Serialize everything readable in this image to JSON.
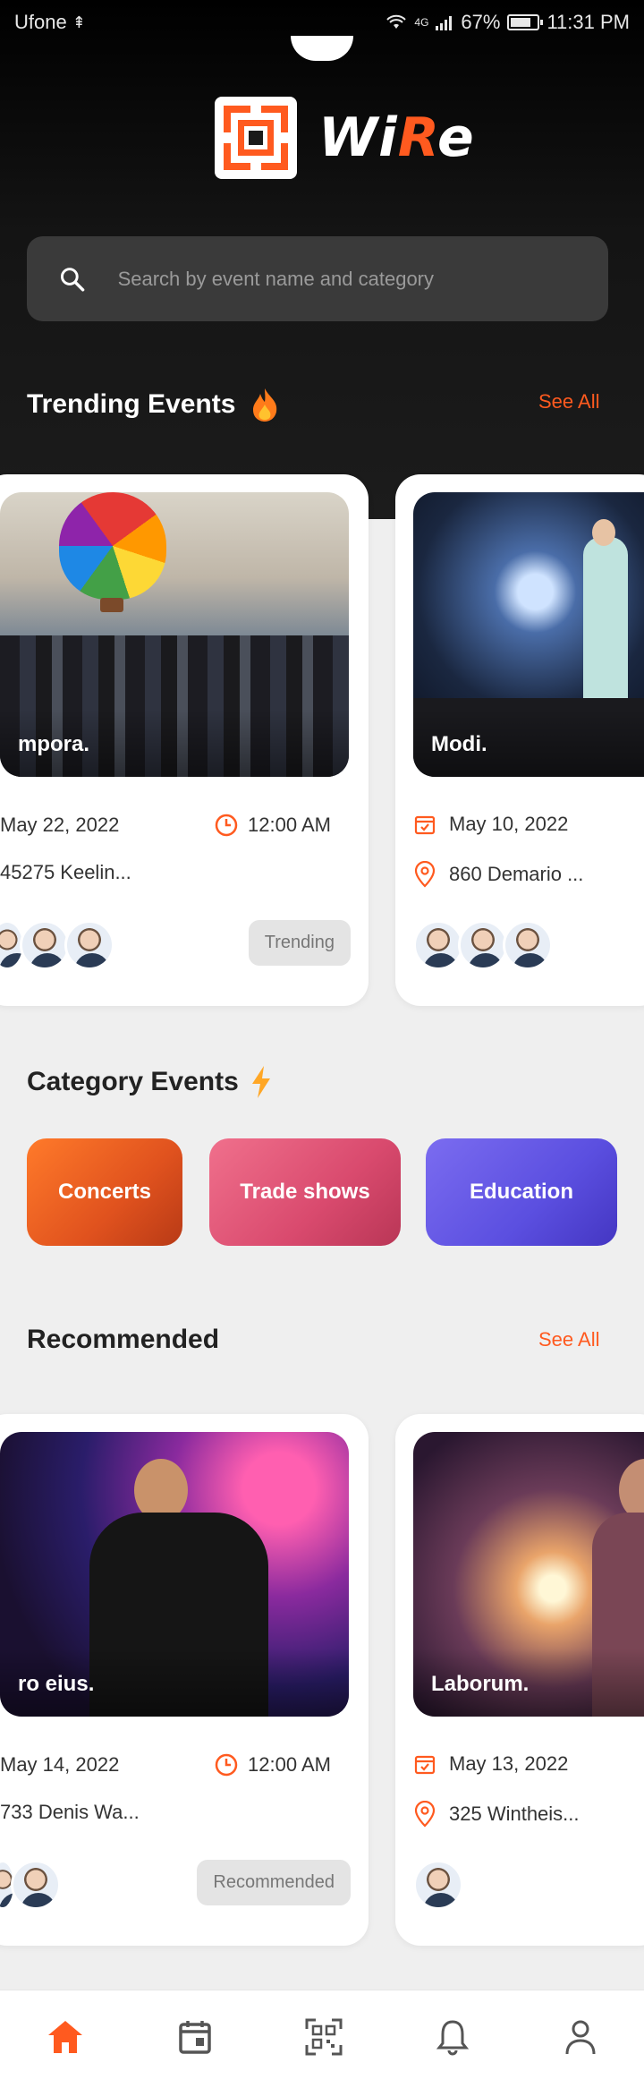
{
  "status_bar": {
    "carrier": "Ufone",
    "network": "4G",
    "battery": "67%",
    "time": "11:31 PM"
  },
  "brand": {
    "name_prefix": "Wi",
    "name_accent": "R",
    "name_suffix": "e",
    "accent_color": "#ff5a1f"
  },
  "search": {
    "placeholder": "Search by event name and category",
    "icon": "search-icon"
  },
  "trending": {
    "title": "Trending Events",
    "title_icon": "fire-icon",
    "see_all": "See All",
    "cards": [
      {
        "name": "mpora.",
        "date": "May 22, 2022",
        "time": "12:00 AM",
        "address": "45275 Keelin...",
        "chip": "Trending"
      },
      {
        "name": "Modi.",
        "date": "May 10, 2022",
        "address": "860 Demario ..."
      }
    ]
  },
  "categories": {
    "title": "Category Events",
    "title_icon": "lightning-icon",
    "items": [
      {
        "label": "Concerts"
      },
      {
        "label": "Trade shows"
      },
      {
        "label": "Education"
      }
    ]
  },
  "recommended": {
    "title": "Recommended",
    "see_all": "See All",
    "cards": [
      {
        "name": "ro eius.",
        "date": "May 14, 2022",
        "time": "12:00 AM",
        "address": "733 Denis Wa...",
        "chip": "Recommended"
      },
      {
        "name": "Laborum.",
        "date": "May 13, 2022",
        "address": "325 Wintheis..."
      }
    ]
  },
  "bottom_nav": {
    "items": [
      {
        "icon": "home-icon",
        "active": true
      },
      {
        "icon": "calendar-icon",
        "active": false
      },
      {
        "icon": "qr-code-icon",
        "active": false
      },
      {
        "icon": "bell-icon",
        "active": false
      },
      {
        "icon": "profile-icon",
        "active": false
      }
    ]
  }
}
